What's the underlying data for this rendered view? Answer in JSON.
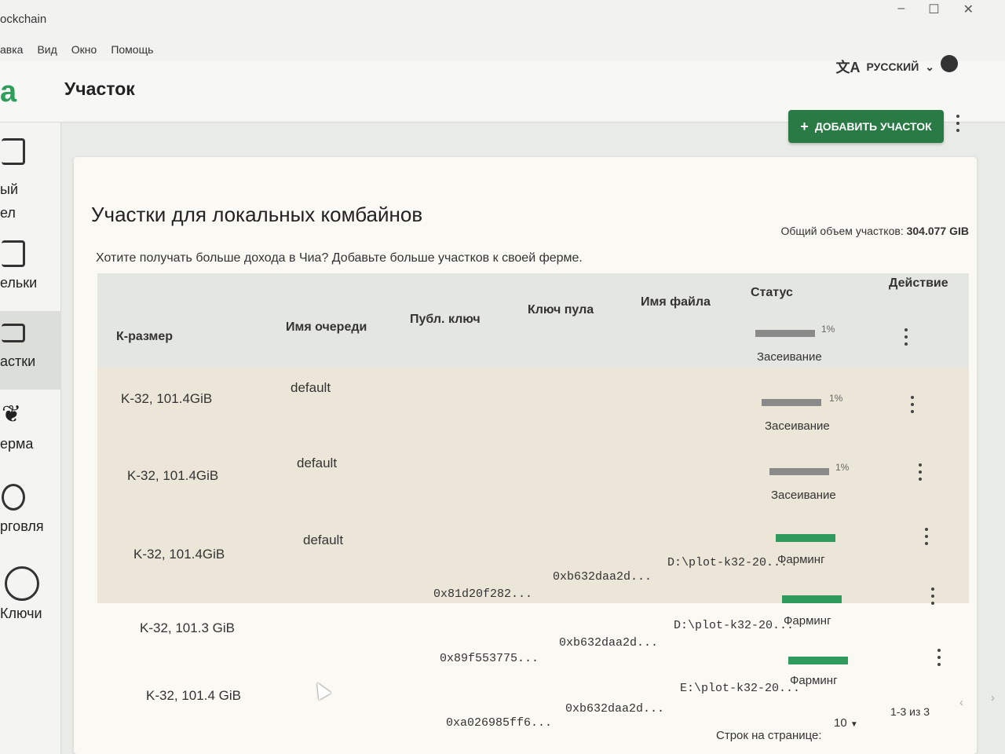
{
  "window": {
    "title": "ockchain",
    "controls": [
      "–",
      "☐",
      "✕"
    ]
  },
  "menu": [
    "авка",
    "Вид",
    "Окно",
    "Помощь"
  ],
  "header": {
    "logo": "a",
    "title": "Участок",
    "language": "РУССКИЙ",
    "language_icon": "translate-icon",
    "theme_icon": "brightness-icon"
  },
  "sidebar": {
    "items": [
      {
        "label": "ый\nел",
        "icon": "wallet-icon"
      },
      {
        "label": "ельки",
        "icon": "wallets-icon"
      },
      {
        "label": "астки",
        "icon": "plots-icon"
      },
      {
        "label": "ерма",
        "icon": "farm-icon"
      },
      {
        "label": "рговля",
        "icon": "trade-icon"
      },
      {
        "label": "Ключи",
        "icon": "keys-icon"
      }
    ],
    "active_index": 2
  },
  "actions": {
    "add_plot": "ДОБАВИТЬ УЧАСТОК",
    "add_icon": "plus-icon"
  },
  "card": {
    "title": "Участки для локальных комбайнов",
    "subtitle": "Хотите получать больше дохода в Чиа? Добавьте больше участков к своей ферме.",
    "total_label": "Общий объем участков:",
    "total_value": "304.077 GIB"
  },
  "table": {
    "columns": [
      "К-размер",
      "Имя очереди",
      "Публ. ключ",
      "Ключ пула",
      "Имя файла",
      "Статус",
      "Действие"
    ],
    "rows": [
      {
        "size": "K-32, 101.4GiB",
        "queue": "default",
        "pub_key": "",
        "pool_key": "",
        "file": "",
        "status": "Засеивание",
        "progress": 0.01,
        "progress_label": "1%"
      },
      {
        "size": "K-32, 101.4GiB",
        "queue": "default",
        "pub_key": "",
        "pool_key": "",
        "file": "",
        "status": "Засеивание",
        "progress": 0.01,
        "progress_label": "1%"
      },
      {
        "size": "K-32, 101.4GiB",
        "queue": "default",
        "pub_key": "",
        "pool_key": "",
        "file": "",
        "status": "Засеивание",
        "progress": 0.01,
        "progress_label": "1%"
      },
      {
        "size": "K-32, 101.3 GiB",
        "queue": "",
        "pub_key": "0x81d20f282...",
        "pool_key": "0xb632daa2d...",
        "file": "D:\\plot-k32-20...",
        "status": "Фарминг",
        "progress": 1,
        "progress_label": ""
      },
      {
        "size": "K-32, 101.4 GiB",
        "queue": "",
        "pub_key": "0x89f553775...",
        "pool_key": "0xb632daa2d...",
        "file": "D:\\plot-k32-20...",
        "status": "Фарминг",
        "progress": 1,
        "progress_label": ""
      },
      {
        "size": "",
        "queue": "",
        "pub_key": "0xa026985ff6...",
        "pool_key": "0xb632daa2d...",
        "file": "E:\\plot-k32-20...",
        "status": "Фарминг",
        "progress": 1,
        "progress_label": ""
      }
    ]
  },
  "pagination": {
    "rows_label": "Строк на странице:",
    "rows_value": "10",
    "range": "1-3 из 3"
  },
  "colors": {
    "accent": "#2a7a45",
    "farming": "#2e9a5c",
    "plotting": "#8a8a8a"
  }
}
